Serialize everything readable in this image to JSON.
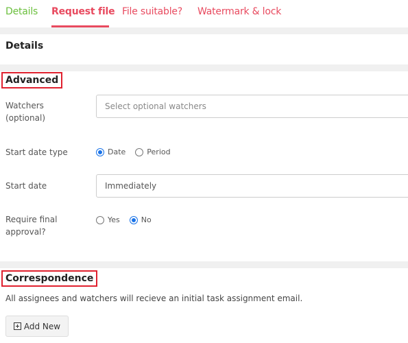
{
  "tabs": [
    {
      "label": "Details",
      "color": "#6abf3c"
    },
    {
      "label": "Request file",
      "active": true,
      "color": "#e84a5f"
    },
    {
      "label": "File suitable?",
      "color": "#e84a5f"
    },
    {
      "label": "Watermark & lock",
      "color": "#e84a5f"
    }
  ],
  "sections": {
    "details_title": "Details",
    "advanced_title": "Advanced",
    "correspondence_title": "Correspondence"
  },
  "form": {
    "watchers": {
      "label_line1": "Watchers",
      "label_line2": "(optional)",
      "placeholder": "Select optional watchers",
      "value": ""
    },
    "start_date_type": {
      "label": "Start date type",
      "options": [
        "Date",
        "Period"
      ],
      "selected": "Date"
    },
    "start_date": {
      "label": "Start date",
      "value": "Immediately"
    },
    "require_final_approval": {
      "label_line1": "Require final",
      "label_line2": "approval?",
      "options": [
        "Yes",
        "No"
      ],
      "selected": "No"
    }
  },
  "correspondence": {
    "description": "All assignees and watchers will recieve an initial task assignment email.",
    "add_new_label": "Add New"
  },
  "colors": {
    "accent": "#e84a5f",
    "highlight_box": "#e0202e",
    "radio_checked": "#1a73e8"
  }
}
